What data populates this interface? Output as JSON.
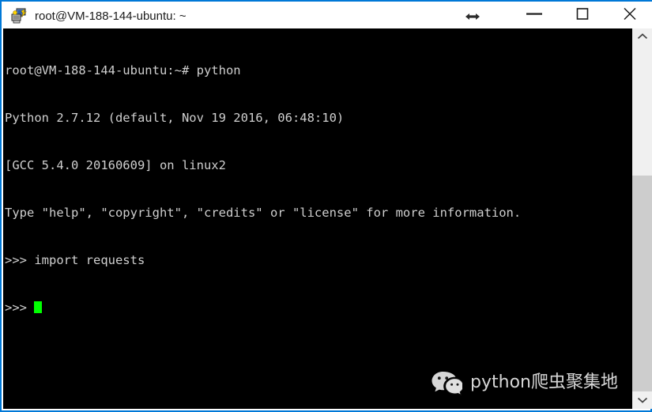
{
  "window": {
    "title": "root@VM-188-144-ubuntu: ~",
    "app_icon": "putty-computer-icon",
    "accent_color": "#0078d7",
    "titlebar_background": "#ffffff",
    "titlebar_text_color": "#1a1a1a"
  },
  "titlebar_controls": {
    "resize_indicator_icon": "horizontal-resize-arrows-icon",
    "minimize_icon": "minimize-icon",
    "maximize_icon": "maximize-icon",
    "close_icon": "close-icon",
    "minimize_label": "Minimize",
    "maximize_label": "Maximize",
    "close_label": "Close"
  },
  "terminal": {
    "background": "#000000",
    "foreground": "#cfcfcf",
    "cursor_color": "#00ff00",
    "lines": [
      "root@VM-188-144-ubuntu:~# python",
      "Python 2.7.12 (default, Nov 19 2016, 06:48:10)",
      "[GCC 5.4.0 20160609] on linux2",
      "Type \"help\", \"copyright\", \"credits\" or \"license\" for more information.",
      ">>> import requests"
    ],
    "prompt": ">>> ",
    "host_prompt": "root@VM-188-144-ubuntu:~#",
    "command": "python",
    "python_version": "2.7.12",
    "build_date": "Nov 19 2016, 06:48:10",
    "compiler": "GCC 5.4.0 20160609",
    "platform": "linux2",
    "imported_module": "requests"
  },
  "watermark": {
    "logo_icon": "wechat-logo-icon",
    "label": "python爬虫聚集地",
    "text_color": "#e8e8e8"
  },
  "scrollbar": {
    "up_arrow_icon": "chevron-up-icon",
    "down_arrow_icon": "chevron-down-icon",
    "track_color": "#f0f0f0",
    "thumb_color": "#cdcdcd"
  }
}
